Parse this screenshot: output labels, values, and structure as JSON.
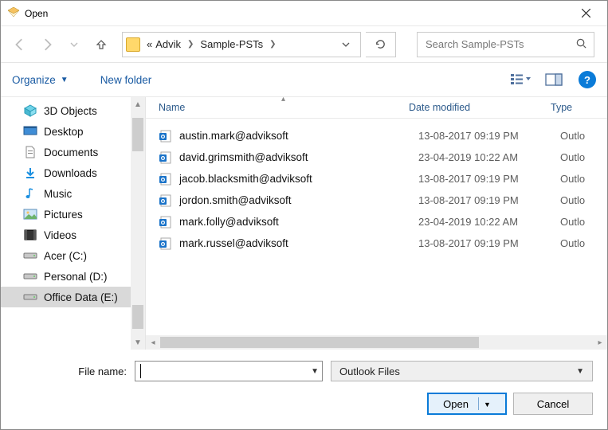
{
  "window": {
    "title": "Open"
  },
  "breadcrumbs": {
    "left_chevron": "«",
    "part1": "Advik",
    "part2": "Sample-PSTs"
  },
  "search": {
    "placeholder": "Search Sample-PSTs"
  },
  "toolbar": {
    "organize": "Organize",
    "new_folder": "New folder",
    "help": "?"
  },
  "columns": {
    "name": "Name",
    "date": "Date modified",
    "type": "Type"
  },
  "nav": {
    "items": [
      {
        "label": "3D Objects",
        "icon": "cube"
      },
      {
        "label": "Desktop",
        "icon": "desktop"
      },
      {
        "label": "Documents",
        "icon": "doc"
      },
      {
        "label": "Downloads",
        "icon": "download"
      },
      {
        "label": "Music",
        "icon": "music"
      },
      {
        "label": "Pictures",
        "icon": "pictures"
      },
      {
        "label": "Videos",
        "icon": "videos"
      },
      {
        "label": "Acer (C:)",
        "icon": "drive"
      },
      {
        "label": "Personal (D:)",
        "icon": "drive"
      },
      {
        "label": "Office Data (E:)",
        "icon": "drive"
      }
    ],
    "selected_index": 9
  },
  "files": [
    {
      "name": "austin.mark@adviksoft",
      "date": "13-08-2017 09:19 PM",
      "type": "Outlo"
    },
    {
      "name": "david.grimsmith@adviksoft",
      "date": "23-04-2019 10:22 AM",
      "type": "Outlo"
    },
    {
      "name": "jacob.blacksmith@adviksoft",
      "date": "13-08-2017 09:19 PM",
      "type": "Outlo"
    },
    {
      "name": "jordon.smith@adviksoft",
      "date": "13-08-2017 09:19 PM",
      "type": "Outlo"
    },
    {
      "name": "mark.folly@adviksoft",
      "date": "23-04-2019 10:22 AM",
      "type": "Outlo"
    },
    {
      "name": "mark.russel@adviksoft",
      "date": "13-08-2017 09:19 PM",
      "type": "Outlo"
    }
  ],
  "footer": {
    "filename_label": "File name:",
    "filename_value": "",
    "filter_label": "Outlook Files",
    "open": "Open",
    "cancel": "Cancel"
  }
}
